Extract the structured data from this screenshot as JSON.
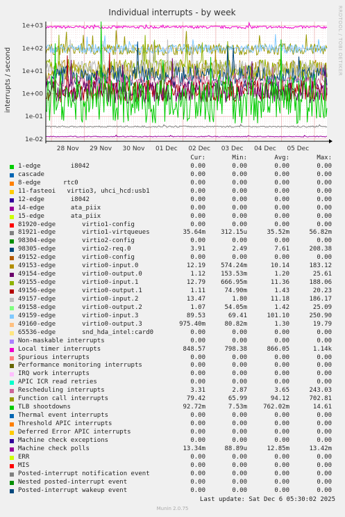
{
  "chart_data": {
    "type": "line",
    "title": "Individual interrupts - by week",
    "ylabel": "interrupts / second",
    "yscale": "log",
    "ylim": [
      0.008,
      1500
    ],
    "yticks": [
      "1e-02",
      "1e-01",
      "1e+00",
      "1e+01",
      "1e+02",
      "1e+03"
    ],
    "x_ticks": [
      "28 Nov",
      "29 Nov",
      "30 Nov",
      "01 Dec",
      "02 Dec",
      "03 Dec",
      "04 Dec",
      "05 Dec"
    ],
    "grid": true,
    "side_label": "RRDTOOL / TOBI OETIKER",
    "columns": [
      "Cur:",
      "Min:",
      "Avg:",
      "Max:"
    ],
    "series": [
      {
        "name": "1-edge        i8042",
        "color": "#00cc00",
        "cur": "0.00",
        "min": "0.00",
        "avg": "0.00",
        "max": "0.00"
      },
      {
        "name": "cascade",
        "color": "#0066b3",
        "cur": "0.00",
        "min": "0.00",
        "avg": "0.00",
        "max": "0.00"
      },
      {
        "name": "8-edge      rtc0",
        "color": "#ff8000",
        "cur": "0.00",
        "min": "0.00",
        "avg": "0.00",
        "max": "0.00"
      },
      {
        "name": "11-fasteoi   virtio3, uhci_hcd:usb1",
        "color": "#ffcc00",
        "cur": "0.00",
        "min": "0.00",
        "avg": "0.00",
        "max": "0.00"
      },
      {
        "name": "12-edge       i8042",
        "color": "#330099",
        "cur": "0.00",
        "min": "0.00",
        "avg": "0.00",
        "max": "0.00"
      },
      {
        "name": "14-edge       ata_piix",
        "color": "#990099",
        "cur": "0.00",
        "min": "0.00",
        "avg": "0.00",
        "max": "0.00"
      },
      {
        "name": "15-edge       ata_piix",
        "color": "#ccff00",
        "cur": "0.00",
        "min": "0.00",
        "avg": "0.00",
        "max": "0.00"
      },
      {
        "name": "81920-edge       virtio1-config",
        "color": "#ff0000",
        "cur": "0.00",
        "min": "0.00",
        "avg": "0.00",
        "max": "0.00"
      },
      {
        "name": "81921-edge       virtio1-virtqueues",
        "color": "#808080",
        "cur": "35.64m",
        "min": "312.15u",
        "avg": "35.52m",
        "max": "56.82m"
      },
      {
        "name": "98304-edge       virtio2-config",
        "color": "#008f00",
        "cur": "0.00",
        "min": "0.00",
        "avg": "0.00",
        "max": "0.00"
      },
      {
        "name": "98305-edge       virtio2-req.0",
        "color": "#00487d",
        "cur": "3.91",
        "min": "2.49",
        "avg": "7.61",
        "max": "208.38"
      },
      {
        "name": "49152-edge       virtio0-config",
        "color": "#b35a00",
        "cur": "0.00",
        "min": "0.00",
        "avg": "0.00",
        "max": "0.00"
      },
      {
        "name": "49153-edge       virtio0-input.0",
        "color": "#b38f00",
        "cur": "12.19",
        "min": "574.24m",
        "avg": "10.14",
        "max": "183.12"
      },
      {
        "name": "49154-edge       virtio0-output.0",
        "color": "#6b006b",
        "cur": "1.12",
        "min": "153.53m",
        "avg": "1.20",
        "max": "25.61"
      },
      {
        "name": "49155-edge       virtio0-input.1",
        "color": "#8fb300",
        "cur": "12.79",
        "min": "666.95m",
        "avg": "11.36",
        "max": "188.06"
      },
      {
        "name": "49156-edge       virtio0-output.1",
        "color": "#b30000",
        "cur": "1.11",
        "min": "74.90m",
        "avg": "1.43",
        "max": "20.23"
      },
      {
        "name": "49157-edge       virtio0-input.2",
        "color": "#bebebe",
        "cur": "13.47",
        "min": "1.80",
        "avg": "11.18",
        "max": "186.17"
      },
      {
        "name": "49158-edge       virtio0-output.2",
        "color": "#80ff80",
        "cur": "1.07",
        "min": "54.05m",
        "avg": "1.42",
        "max": "25.09"
      },
      {
        "name": "49159-edge       virtio0-input.3",
        "color": "#80c9ff",
        "cur": "89.53",
        "min": "69.41",
        "avg": "101.10",
        "max": "250.90"
      },
      {
        "name": "49160-edge       virtio0-output.3",
        "color": "#ffc080",
        "cur": "975.40m",
        "min": "80.82m",
        "avg": "1.30",
        "max": "19.79"
      },
      {
        "name": "65536-edge       snd_hda_intel:card0",
        "color": "#ffe680",
        "cur": "0.00",
        "min": "0.00",
        "avg": "0.00",
        "max": "0.00"
      },
      {
        "name": "Non-maskable interrupts",
        "color": "#aa80ff",
        "cur": "0.00",
        "min": "0.00",
        "avg": "0.00",
        "max": "0.00"
      },
      {
        "name": "Local timer interrupts",
        "color": "#ee00cc",
        "cur": "848.57",
        "min": "798.38",
        "avg": "866.05",
        "max": "1.14k"
      },
      {
        "name": "Spurious interrupts",
        "color": "#ff8080",
        "cur": "0.00",
        "min": "0.00",
        "avg": "0.00",
        "max": "0.00"
      },
      {
        "name": "Performance monitoring interrupts",
        "color": "#666600",
        "cur": "0.00",
        "min": "0.00",
        "avg": "0.00",
        "max": "0.00"
      },
      {
        "name": "IRQ work interrupts",
        "color": "#ffbfff",
        "cur": "0.00",
        "min": "0.00",
        "avg": "0.00",
        "max": "0.00"
      },
      {
        "name": "APIC ICR read retries",
        "color": "#00ffcc",
        "cur": "0.00",
        "min": "0.00",
        "avg": "0.00",
        "max": "0.00"
      },
      {
        "name": "Rescheduling interrupts",
        "color": "#cc6699",
        "cur": "3.31",
        "min": "2.87",
        "avg": "3.65",
        "max": "243.03"
      },
      {
        "name": "Function call interrupts",
        "color": "#999900",
        "cur": "79.42",
        "min": "65.99",
        "avg": "94.12",
        "max": "702.81"
      },
      {
        "name": "TLB shootdowns",
        "color": "#00cc00",
        "cur": "92.72m",
        "min": "7.53m",
        "avg": "762.02m",
        "max": "14.61"
      },
      {
        "name": "Thermal event interrupts",
        "color": "#0066b3",
        "cur": "0.00",
        "min": "0.00",
        "avg": "0.00",
        "max": "0.00"
      },
      {
        "name": "Threshold APIC interrupts",
        "color": "#ff8000",
        "cur": "0.00",
        "min": "0.00",
        "avg": "0.00",
        "max": "0.00"
      },
      {
        "name": "Deferred Error APIC interrupts",
        "color": "#ffcc00",
        "cur": "0.00",
        "min": "0.00",
        "avg": "0.00",
        "max": "0.00"
      },
      {
        "name": "Machine check exceptions",
        "color": "#330099",
        "cur": "0.00",
        "min": "0.00",
        "avg": "0.00",
        "max": "0.00"
      },
      {
        "name": "Machine check polls",
        "color": "#990099",
        "cur": "13.34m",
        "min": "88.89u",
        "avg": "12.85m",
        "max": "13.42m"
      },
      {
        "name": "ERR",
        "color": "#ccff00",
        "cur": "0.00",
        "min": "0.00",
        "avg": "0.00",
        "max": "0.00"
      },
      {
        "name": "MIS",
        "color": "#ff0000",
        "cur": "0.00",
        "min": "0.00",
        "avg": "0.00",
        "max": "0.00"
      },
      {
        "name": "Posted-interrupt notification event",
        "color": "#808080",
        "cur": "0.00",
        "min": "0.00",
        "avg": "0.00",
        "max": "0.00"
      },
      {
        "name": "Nested posted-interrupt event",
        "color": "#008f00",
        "cur": "0.00",
        "min": "0.00",
        "avg": "0.00",
        "max": "0.00"
      },
      {
        "name": "Posted-interrupt wakeup event",
        "color": "#00487d",
        "cur": "0.00",
        "min": "0.00",
        "avg": "0.00",
        "max": "0.00"
      }
    ],
    "plotted_lines": [
      {
        "color": "#ee00cc",
        "base": 850,
        "jitter": 0.06
      },
      {
        "color": "#999900",
        "base": 90,
        "jitter": 0.25
      },
      {
        "color": "#80c9ff",
        "base": 95,
        "jitter": 0.2
      },
      {
        "color": "#b38f00",
        "base": 11,
        "jitter": 0.45
      },
      {
        "color": "#8fb300",
        "base": 12,
        "jitter": 0.45
      },
      {
        "color": "#bebebe",
        "base": 12,
        "jitter": 0.4
      },
      {
        "color": "#00487d",
        "base": 6,
        "jitter": 0.45
      },
      {
        "color": "#cc6699",
        "base": 3.5,
        "jitter": 0.25
      },
      {
        "color": "#b30000",
        "base": 1.3,
        "jitter": 0.5
      },
      {
        "color": "#6b006b",
        "base": 1.2,
        "jitter": 0.5
      },
      {
        "color": "#00cc00",
        "base": 0.6,
        "jitter": 1.1
      },
      {
        "color": "#808080",
        "base": 0.0355,
        "jitter": 0.03
      },
      {
        "color": "#990099",
        "base": 0.0128,
        "jitter": 0.02
      }
    ]
  },
  "last_update": "Last update: Sat Dec  6 05:30:02 2025",
  "footer": "Munin 2.0.75"
}
